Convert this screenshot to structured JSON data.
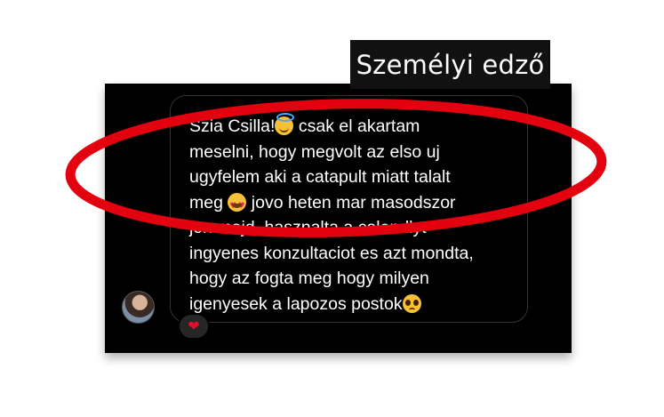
{
  "annotation": {
    "label": "Személyi edző",
    "highlight_color": "#e3000f"
  },
  "message": {
    "lines": [
      {
        "before": "Szia Csilla!",
        "emoji": "smiling-face-with-halo-icon",
        "after": " csak el akartam"
      },
      {
        "text": "meselni, hogy megvolt az elso uj"
      },
      {
        "text": "ugyfelem aki a catapult miatt talalt"
      },
      {
        "before": "meg ",
        "emoji": "heart-eyes-icon",
        "after": " jovo heten mar masodszor"
      },
      {
        "text": "jon majd, hasznalta a calendlyt"
      },
      {
        "text": "ingyenes konzultaciot es azt mondta,"
      },
      {
        "text": "hogy az fogta meg hogy milyen"
      },
      {
        "before": "igenyesek a lapozos postok",
        "emoji": "pleading-face-icon",
        "after": ""
      }
    ]
  },
  "reaction": {
    "icon": "heart-icon"
  },
  "colors": {
    "background": "#000000",
    "bubble_border": "#333333",
    "text": "#ffffff",
    "reaction_bg": "#262626",
    "heart": "#e0102a"
  }
}
